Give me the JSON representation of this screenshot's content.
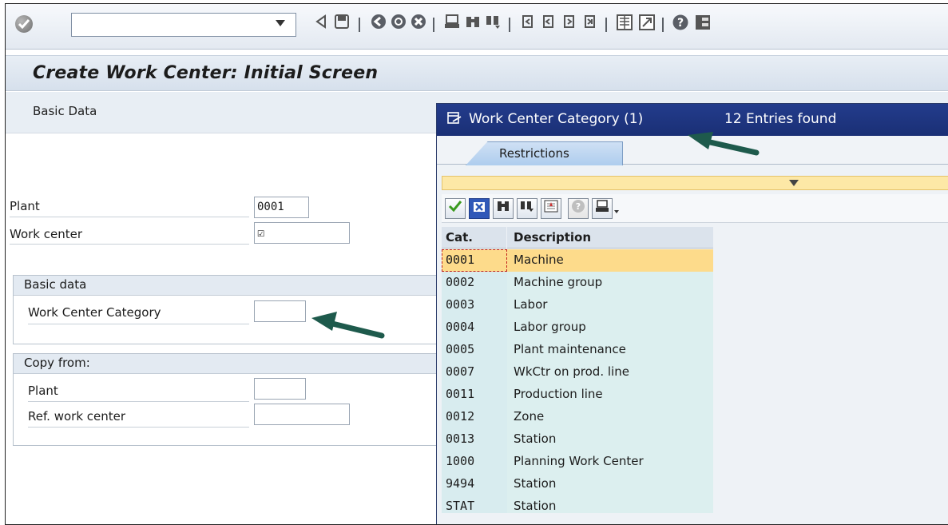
{
  "toolbar": {
    "command_field_value": "",
    "icons": [
      "enter-icon",
      "back-icon",
      "save-icon",
      "back-nav-icon",
      "exit-icon",
      "cancel-icon",
      "print-icon",
      "find-icon",
      "find-next-icon",
      "first-page-icon",
      "prev-page-icon",
      "next-page-icon",
      "last-page-icon",
      "new-session-icon",
      "shortcut-icon",
      "help-icon",
      "layout-icon"
    ]
  },
  "title": "Create Work Center: Initial Screen",
  "appbar": {
    "basic_data_button": "Basic Data"
  },
  "form": {
    "plant_label": "Plant",
    "plant_value": "0001",
    "work_center_label": "Work center",
    "work_center_value": "☑",
    "basic_data_group": {
      "title": "Basic data",
      "category_label": "Work Center Category",
      "category_value": ""
    },
    "copy_from_group": {
      "title": "Copy from:",
      "plant_label": "Plant",
      "plant_value": "",
      "ref_label": "Ref. work center",
      "ref_value": ""
    }
  },
  "popup": {
    "title": "Work Center Category (1)",
    "count": "12 Entries found",
    "tab": "Restrictions",
    "columns": {
      "cat": "Cat.",
      "desc": "Description"
    },
    "rows": [
      {
        "cat": "0001",
        "desc": "Machine",
        "selected": true
      },
      {
        "cat": "0002",
        "desc": "Machine group"
      },
      {
        "cat": "0003",
        "desc": "Labor"
      },
      {
        "cat": "0004",
        "desc": "Labor group"
      },
      {
        "cat": "0005",
        "desc": "Plant maintenance"
      },
      {
        "cat": "0007",
        "desc": "WkCtr on prod. line"
      },
      {
        "cat": "0011",
        "desc": "Production line"
      },
      {
        "cat": "0012",
        "desc": "Zone"
      },
      {
        "cat": "0013",
        "desc": "Station"
      },
      {
        "cat": "1000",
        "desc": "Planning Work Center"
      },
      {
        "cat": "9494",
        "desc": "Station"
      },
      {
        "cat": "STAT",
        "desc": "Station"
      }
    ]
  },
  "colors": {
    "popup_title_bg": "#1f358a",
    "selected_row": "#fddb8b",
    "arrow": "#1e5a4c"
  }
}
